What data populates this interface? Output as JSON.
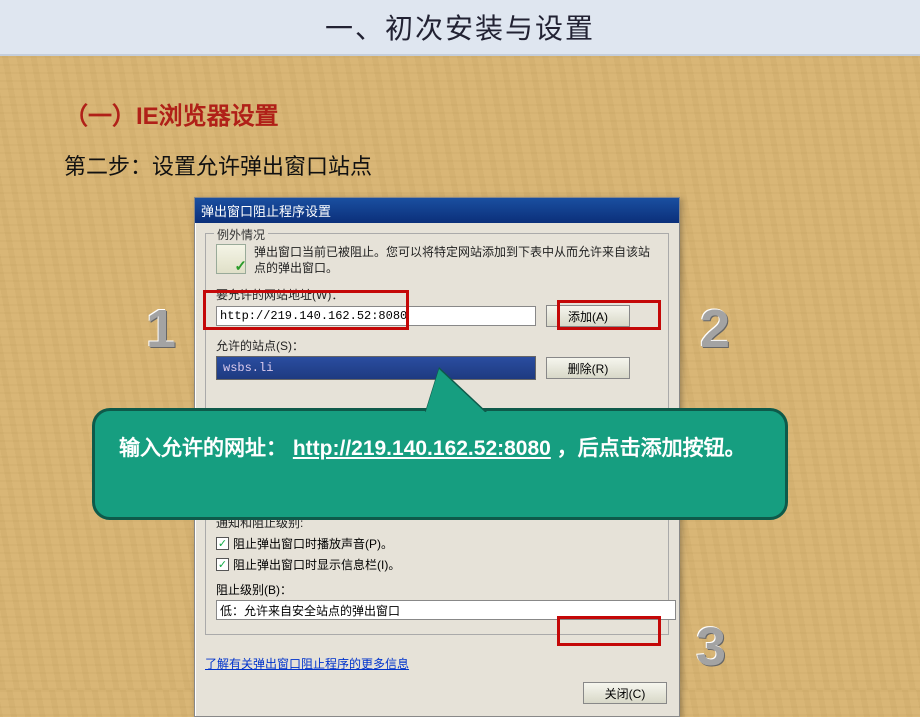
{
  "slide": {
    "title": "一、初次安装与设置",
    "section": "（一）IE浏览器设置",
    "step": "第二步：设置允许弹出窗口站点"
  },
  "dialog": {
    "title": "弹出窗口阻止程序设置",
    "group_legend": "例外情况",
    "description": "弹出窗口当前已被阻止。您可以将特定网站添加到下表中从而允许来自该站点的弹出窗口。",
    "address_label": "要允许的网站地址(W)：",
    "address_value": "http://219.140.162.52:8080",
    "add_button": "添加(A)",
    "allowed_label": "允许的站点(S)：",
    "allowed_item": "wsbs.li",
    "remove_button": "删除(R)",
    "notify_legend": "通知和阻止级别:",
    "cb_sound": "阻止弹出窗口时播放声音(P)。",
    "cb_infobar": "阻止弹出窗口时显示信息栏(I)。",
    "level_label": "阻止级别(B)：",
    "level_value": "低：允许来自安全站点的弹出窗口",
    "link_more": "了解有关弹出窗口阻止程序的更多信息",
    "close_button": "关闭(C)"
  },
  "callout": {
    "prefix": "输入允许的网址： ",
    "url": "http://219.140.162.52:8080",
    "suffix": "，后点击添加按钮。"
  },
  "markers": {
    "n1": "1",
    "n2": "2",
    "n3": "3"
  }
}
